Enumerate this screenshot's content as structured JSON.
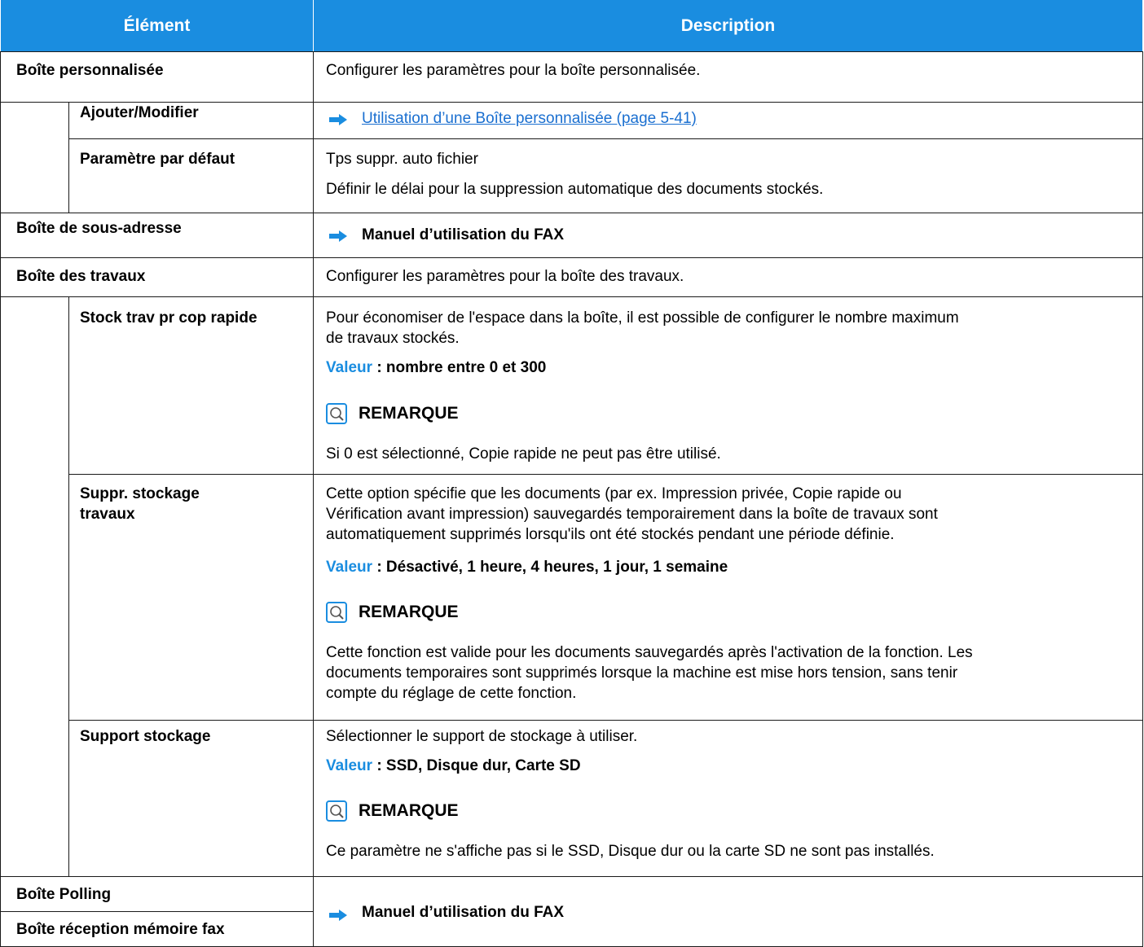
{
  "header": {
    "element": "Élément",
    "description": "Description"
  },
  "rows": {
    "perso": {
      "label": "Boîte personnalisée",
      "desc": "Configurer les paramètres pour la boîte personnalisée."
    },
    "ajouter": {
      "label": "Ajouter/Modifier",
      "link": "Utilisation d’une Boîte personnalisée (page 5-41)"
    },
    "defaut": {
      "label": "Paramètre par défaut",
      "line1": "Tps suppr. auto fichier",
      "line2": "Définir le délai pour la suppression automatique des documents stockés."
    },
    "sousadr": {
      "label": "Boîte de sous-adresse",
      "ref": "Manuel d’utilisation du FAX"
    },
    "travaux": {
      "label": "Boîte des travaux",
      "desc": "Configurer les paramètres pour la boîte des travaux."
    },
    "stock": {
      "label": "Stock trav pr cop rapide",
      "desc1": "Pour économiser de l'espace dans la boîte, il est possible de configurer le nombre maximum",
      "desc2": "de travaux stockés.",
      "value_key": "Valeur",
      "value": " : nombre entre 0 et 300",
      "note_title": "REMARQUE",
      "note": "Si 0 est sélectionné, Copie rapide ne peut pas être utilisé."
    },
    "suppr": {
      "label1": "Suppr. stockage",
      "label2": "travaux",
      "desc1": "Cette option spécifie que les documents (par ex. Impression privée, Copie rapide ou",
      "desc2": "Vérification avant impression) sauvegardés temporairement dans la boîte de travaux sont",
      "desc3": "automatiquement supprimés lorsqu'ils ont été stockés pendant une période définie.",
      "value_key": "Valeur",
      "value": " : Désactivé, 1 heure, 4 heures, 1 jour, 1 semaine",
      "note_title": "REMARQUE",
      "note1": "Cette fonction est valide pour les documents sauvegardés après l'activation de la fonction. Les",
      "note2": "documents temporaires sont supprimés lorsque la machine est mise hors tension, sans tenir",
      "note3": "compte du réglage de cette fonction."
    },
    "support": {
      "label": "Support stockage",
      "desc": "Sélectionner le support de stockage à utiliser.",
      "value_key": "Valeur",
      "value": " : SSD, Disque dur, Carte SD",
      "note_title": "REMARQUE",
      "note": "Ce paramètre ne s'affiche pas si le SSD, Disque dur ou la carte SD ne sont pas installés."
    },
    "polling": {
      "label": "Boîte Polling"
    },
    "reception": {
      "label": "Boîte réception mémoire fax"
    },
    "fax_ref": "Manuel d’utilisation du FAX"
  },
  "icons": {
    "arrow": "arrow-right-icon",
    "note": "lightbulb-note-icon"
  },
  "colors": {
    "header_bg": "#1a8de0",
    "accent": "#1a8de0",
    "link": "#1a6fd0"
  }
}
